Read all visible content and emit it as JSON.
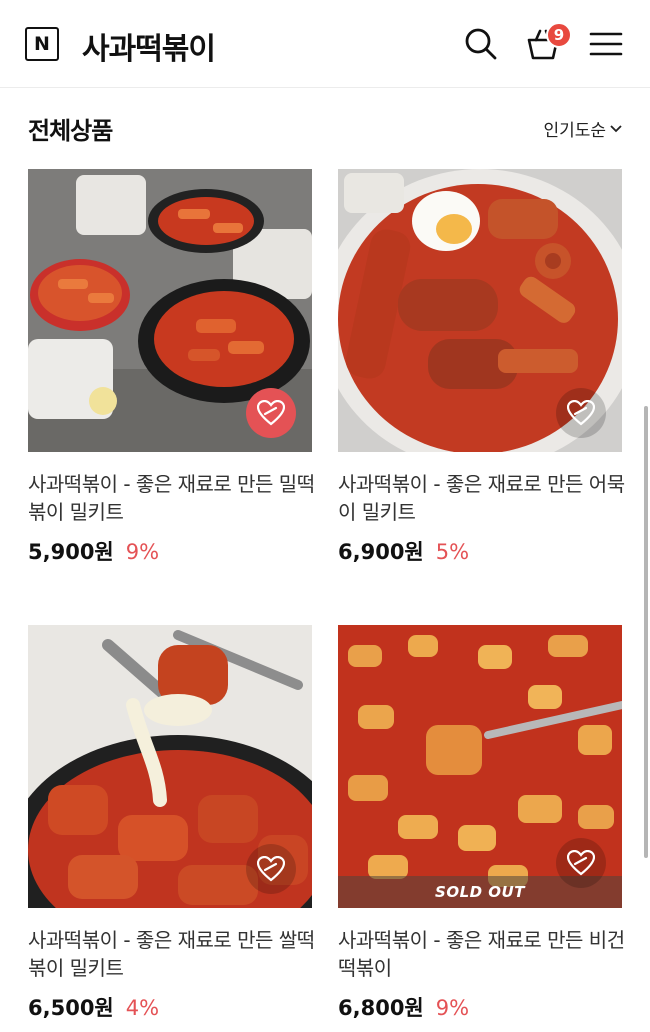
{
  "header": {
    "logo_letter": "N",
    "brand": "사과떡볶이",
    "cart_count": "9"
  },
  "section": {
    "title": "전체상품",
    "sort_label": "인기도순"
  },
  "products": [
    {
      "name": "사과떡볶이 - 좋은 재료로 만든 밀떡볶이 밀키트",
      "price": "5,900원",
      "discount": "9%",
      "sold_out": false,
      "liked": true
    },
    {
      "name": "사과떡볶이 - 좋은 재료로 만든 어묵이 밀키트",
      "price": "6,900원",
      "discount": "5%",
      "sold_out": false,
      "liked": false
    },
    {
      "name": "사과떡볶이 - 좋은 재료로 만든 쌀떡볶이 밀키트",
      "price": "6,500원",
      "discount": "4%",
      "sold_out": false,
      "liked": false
    },
    {
      "name": "사과떡볶이 - 좋은 재료로 만든 비건떡볶이",
      "price": "6,800원",
      "discount": "9%",
      "sold_out": true,
      "sold_out_label": "SOLD OUT",
      "liked": false
    }
  ],
  "icons": [
    "logo-icon",
    "search-icon",
    "cart-icon",
    "menu-icon",
    "chevron-down-icon",
    "heart-icon"
  ],
  "colors": {
    "accent": "#e45255",
    "badge": "#e8493f",
    "sauce": "#c8391f"
  }
}
